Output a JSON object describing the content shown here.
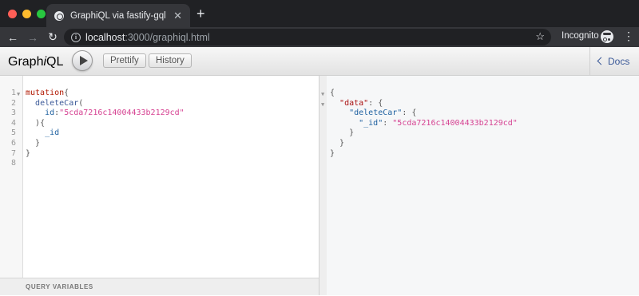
{
  "browser": {
    "tab_title": "GraphiQL via fastify-gql",
    "url_host": "localhost",
    "url_path": ":3000/graphiql.html",
    "incognito_label": "Incognito",
    "colors": {
      "close": "#ff5f57",
      "minimize": "#febc2e",
      "maximize": "#28c840"
    }
  },
  "graphiql": {
    "logo_prefix": "Graph",
    "logo_i": "i",
    "logo_suffix": "QL",
    "prettify_label": "Prettify",
    "history_label": "History",
    "docs_label": "Docs",
    "query_variables_label": "QUERY VARIABLES"
  },
  "query": {
    "line_numbers": [
      "1",
      "2",
      "3",
      "4",
      "5",
      "6",
      "7",
      "8"
    ],
    "keyword": "mutation",
    "field": "deleteCar",
    "arg_name": "id",
    "arg_value": "\"5cda7216c14004433b2129cd\"",
    "selection": "_id"
  },
  "result": {
    "data_key": "\"data\"",
    "delete_key": "\"deleteCar\"",
    "id_key": "\"_id\"",
    "id_value": "\"5cda7216c14004433b2129cd\""
  }
}
